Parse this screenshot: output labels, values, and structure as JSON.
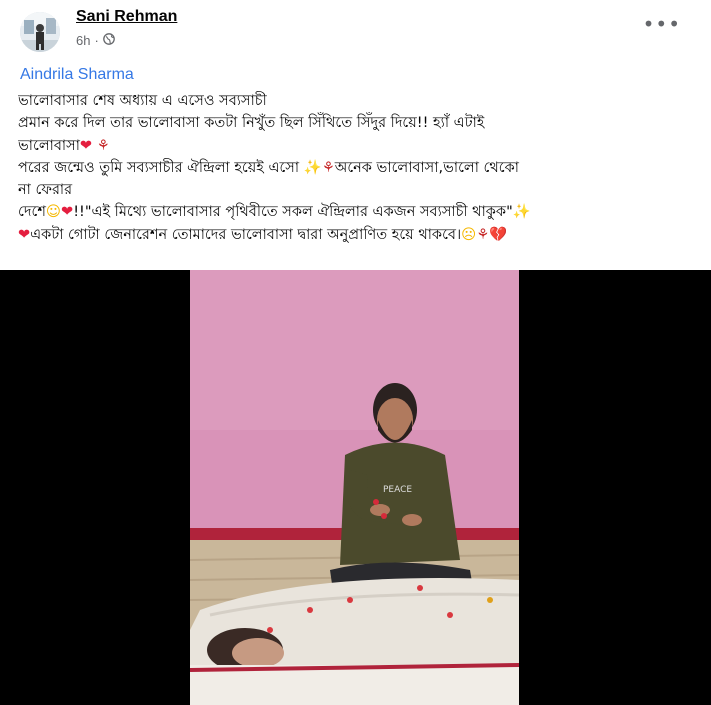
{
  "post": {
    "author": "Sani Rehman",
    "time": "6h",
    "privacy_icon": "globe-icon",
    "more_icon": "more-options-icon",
    "tagged": "Aindrila Sharma",
    "lines": [
      "ভালোবাসার শেষ অধ্যায় এ এসেও সব্যসাচী",
      "প্রমান করে দিল তার ভালোবাসা কতটা নিখুঁত ছিল সিঁথিতে সিঁদুর দিয়ে!! হ্যাঁ এটাই",
      "ভালোবাসা",
      "পরের জন্মেও তুমি সব্যসাচীর ঐন্দ্রিলা হয়েই এসো ",
      "অনেক ভালোবাসা,ভালো থেকো",
      "না ফেরার",
      "দেশে",
      "!!\"এই মিথ্যে ভালোবাসার পৃথিবীতে সকল ঐন্দ্রিলার একজন সব্যসাচী থাকুক\"",
      "একটা গোটা জেনারেশন তোমাদের ভালোবাসা দ্বারা অনুপ্রাণিত হয়ে থাকবে।"
    ],
    "shirt_text": "PEACE"
  }
}
